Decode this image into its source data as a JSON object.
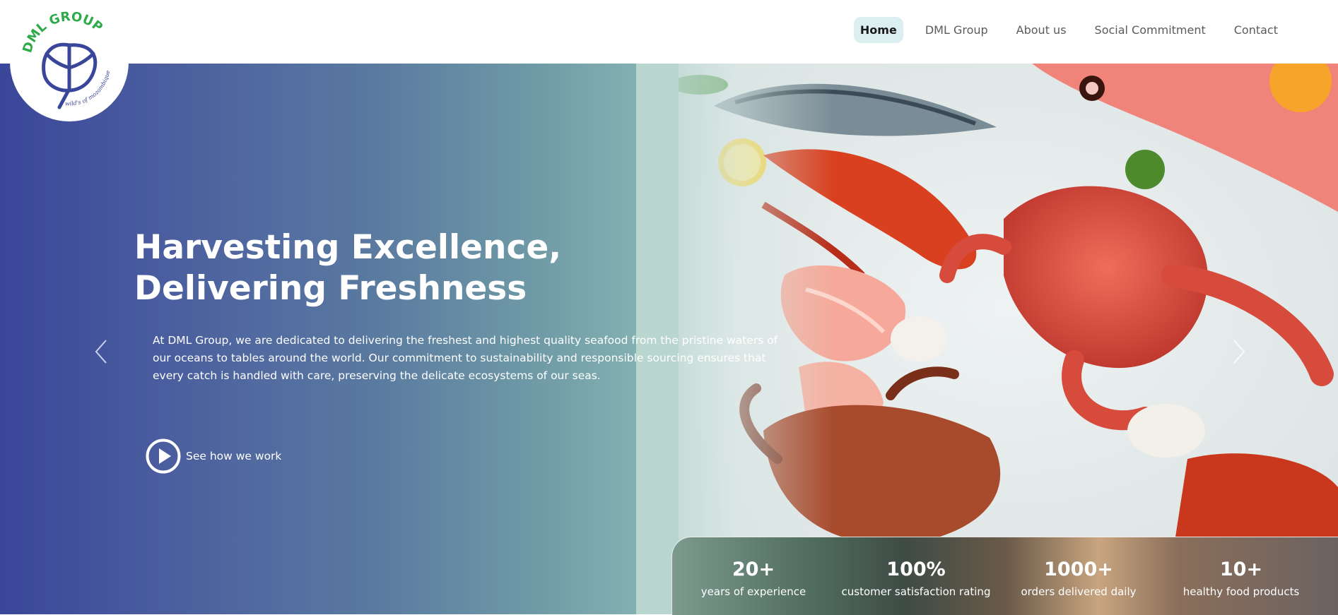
{
  "brand": {
    "name": "DML GROUP",
    "tagline": "wild's of mozambique",
    "logo_color": "#3a4699",
    "logo_accent": "#2eaa4a"
  },
  "nav": {
    "items": [
      {
        "label": "Home",
        "active": true
      },
      {
        "label": "DML Group"
      },
      {
        "label": "About us"
      },
      {
        "label": "Social Commitment"
      },
      {
        "label": "Contact"
      }
    ]
  },
  "hero": {
    "title": "Harvesting Excellence, Delivering Freshness",
    "description": "At DML Group, we are dedicated to delivering the freshest and highest quality seafood from the pristine waters of our oceans to tables around the world. Our commitment to sustainability and responsible sourcing ensures that every catch is handled with care, preserving the delicate ecosystems of our seas.",
    "cta_label": "See how we work",
    "prev_icon": "chevron-left-icon",
    "next_icon": "chevron-right-icon"
  },
  "stats": [
    {
      "value": "20+",
      "label": "years of experience"
    },
    {
      "value": "100%",
      "label": "customer satisfaction rating"
    },
    {
      "value": "1000+",
      "label": "orders delivered daily"
    },
    {
      "value": "10+",
      "label": "healthy food products"
    }
  ]
}
